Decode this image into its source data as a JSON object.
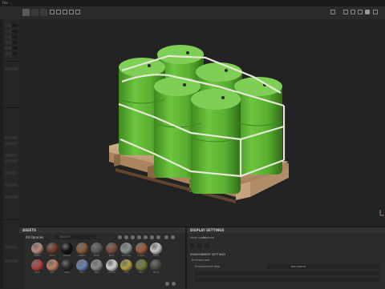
{
  "titlebar": {
    "menu": "File"
  },
  "toolbar": {
    "viewport_mode": "Material"
  },
  "left_panel": {
    "labels": [
      "Cam",
      "Vis",
      "Env",
      "Light",
      "Shad"
    ]
  },
  "assets": {
    "title": "ASSETS",
    "filter": "All libraries",
    "search_placeholder": "Search",
    "materials": [
      {
        "label": "Plastic",
        "color": "#b98a7a"
      },
      {
        "label": "Wood",
        "color": "#6b3c22"
      },
      {
        "label": "Rubber",
        "color": "#111111"
      },
      {
        "label": "Leather",
        "color": "#8a5a3a"
      },
      {
        "label": "Metal",
        "color": "#5a5a5a"
      },
      {
        "label": "Brick",
        "color": "#7a4a3a"
      },
      {
        "label": "Concrete",
        "color": "#8f8f8f"
      },
      {
        "label": "Copper",
        "color": "#9a5a3a"
      },
      {
        "label": "Fabric",
        "color": "#c6c6c6"
      },
      {
        "label": "Paint",
        "color": "#b43f3f"
      },
      {
        "label": "Cork",
        "color": "#c08060"
      },
      {
        "label": "Dark",
        "color": "#2a2a2a"
      },
      {
        "label": "Blue",
        "color": "#6a7fb0"
      },
      {
        "label": "Steel",
        "color": "#8a8a8a"
      },
      {
        "label": "Chrome",
        "color": "#d0d0d0"
      },
      {
        "label": "Gold",
        "color": "#b0a040"
      },
      {
        "label": "Olive",
        "color": "#6f7a3a"
      },
      {
        "label": "Stone",
        "color": "#4a4a44"
      }
    ]
  },
  "display": {
    "title": "DISPLAY SETTINGS",
    "view_mode_label": "View mode",
    "view_mode_value": "Material",
    "section": "ENVIRONMENT SETTINGS",
    "env_label": "Environment",
    "env_map_label": "Environment Map",
    "env_map_value": "panorama"
  },
  "colors": {
    "barrel_green": "#5cb834",
    "strap": "#e8e8d8",
    "pallet": "#c8a582"
  }
}
